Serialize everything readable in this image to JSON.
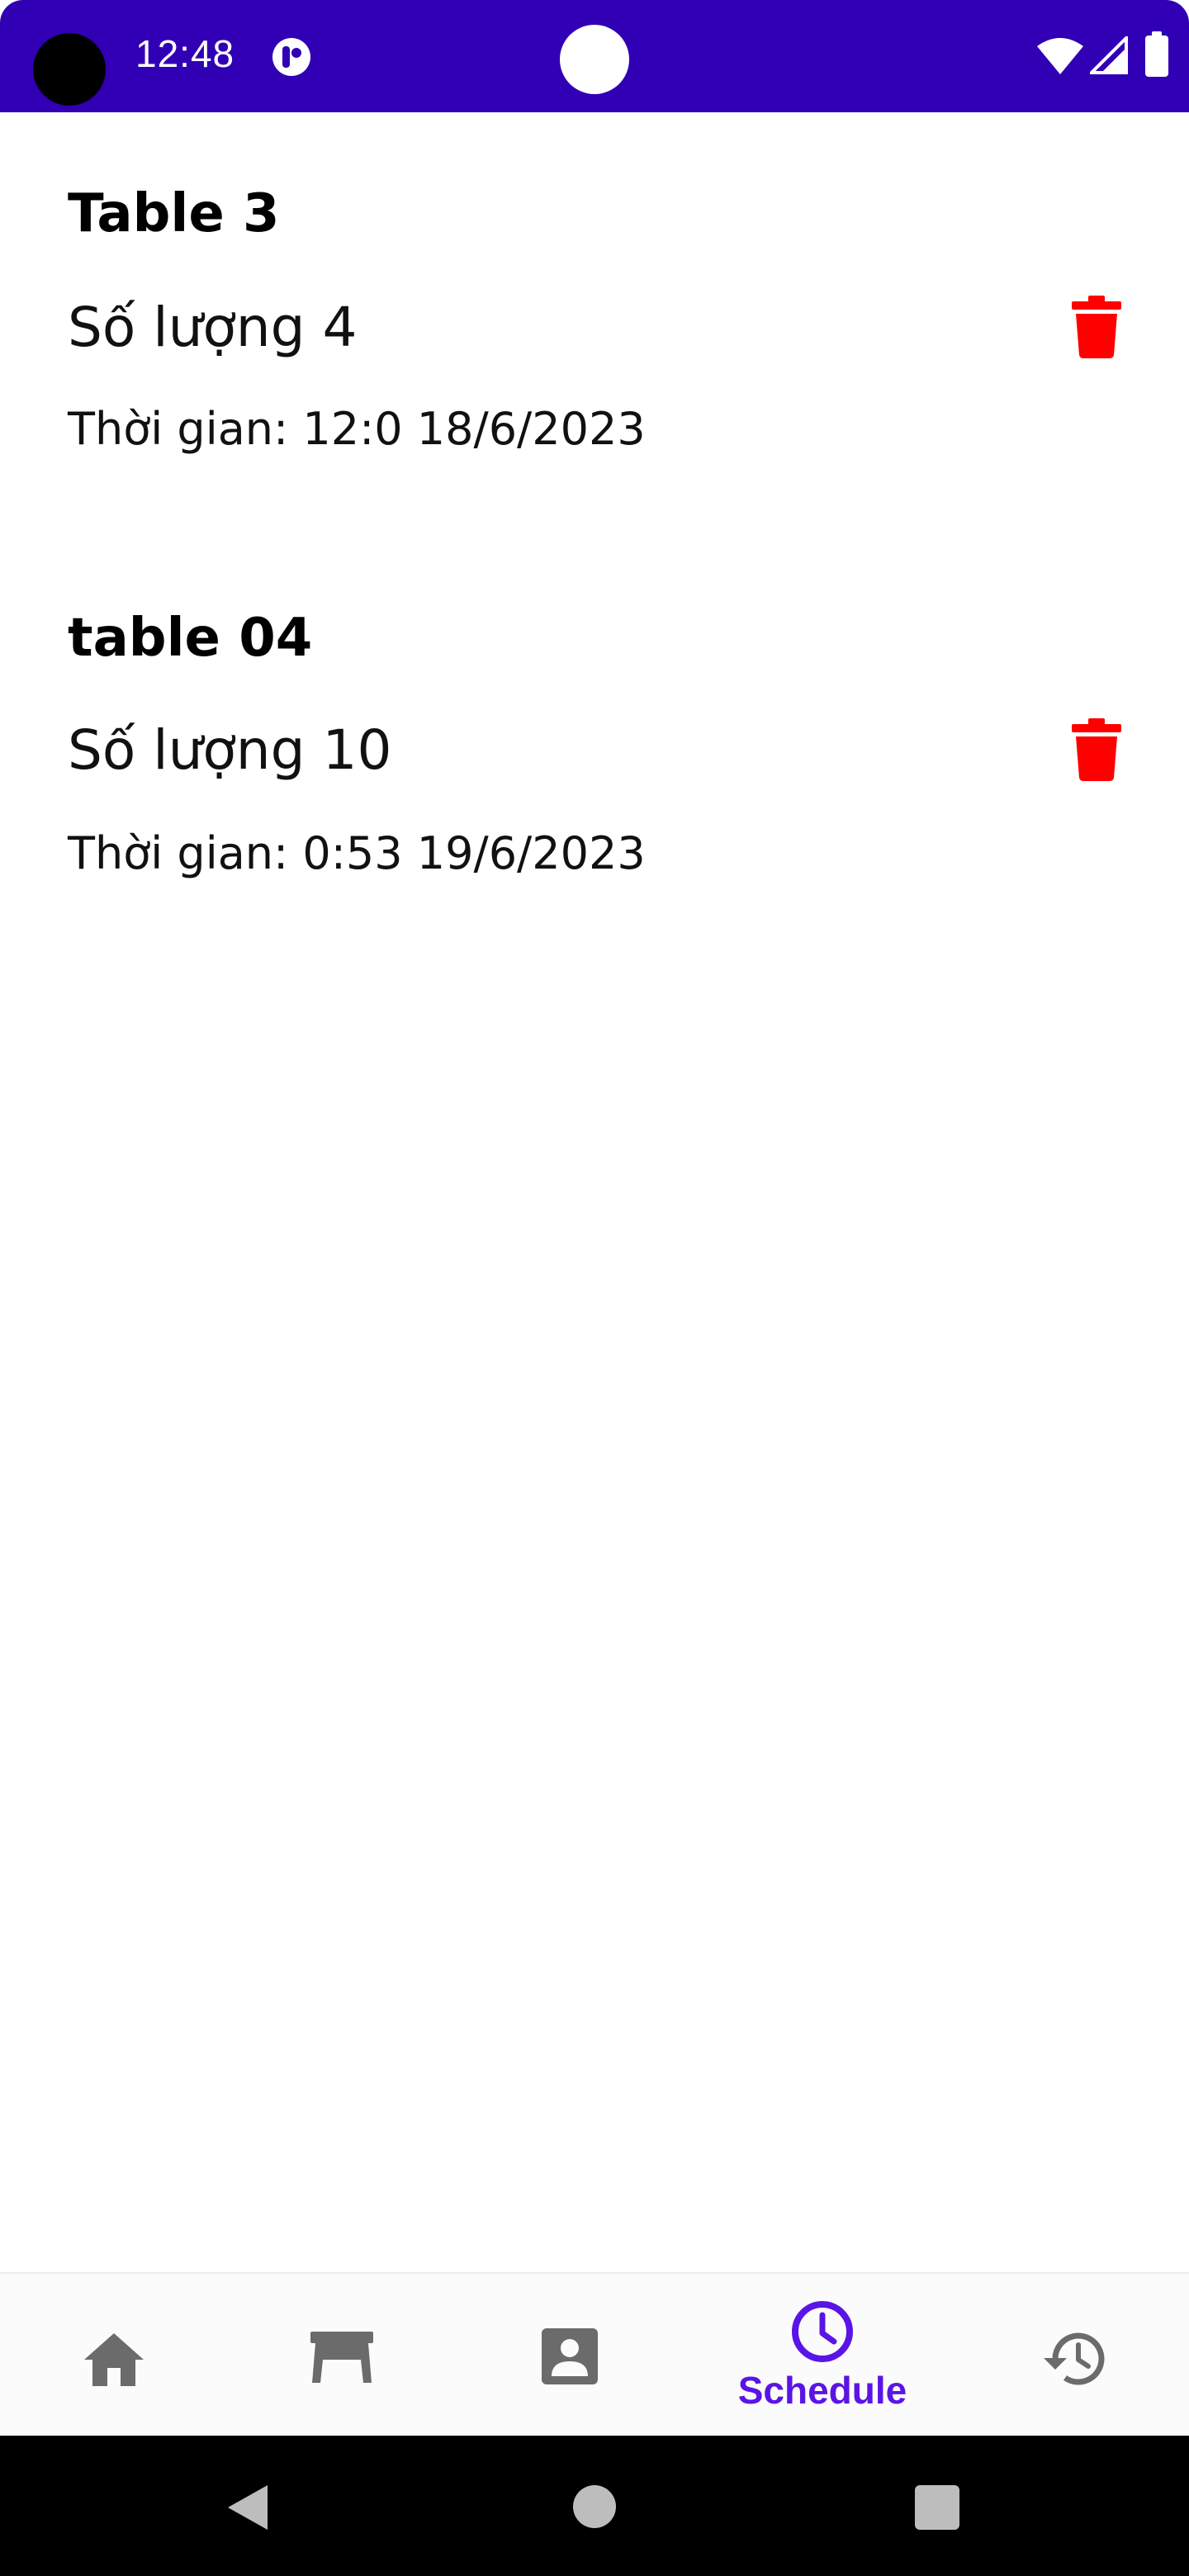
{
  "status_bar": {
    "time": "12:48",
    "background_color": "#3100b5",
    "icons": [
      "app-notification-icon",
      "wifi-icon",
      "signal-icon",
      "battery-icon"
    ]
  },
  "bookings": [
    {
      "table_name": "Table 3",
      "quantity": "Số lượng 4",
      "time": "Thời gian: 12:0 18/6/2023",
      "delete_icon": "trash-icon"
    },
    {
      "table_name": "table 04",
      "quantity": "Số lượng 10",
      "time": "Thời gian: 0:53 19/6/2023",
      "delete_icon": "trash-icon"
    }
  ],
  "bottom_nav": {
    "items": [
      {
        "icon": "home-icon",
        "label": ""
      },
      {
        "icon": "table-icon",
        "label": ""
      },
      {
        "icon": "profile-icon",
        "label": ""
      },
      {
        "icon": "clock-icon",
        "label": "Schedule",
        "selected": true
      },
      {
        "icon": "history-icon",
        "label": ""
      }
    ],
    "active_color": "#5b14e6",
    "inactive_color": "#6b6b6b"
  },
  "delete_color": "#ff0000"
}
